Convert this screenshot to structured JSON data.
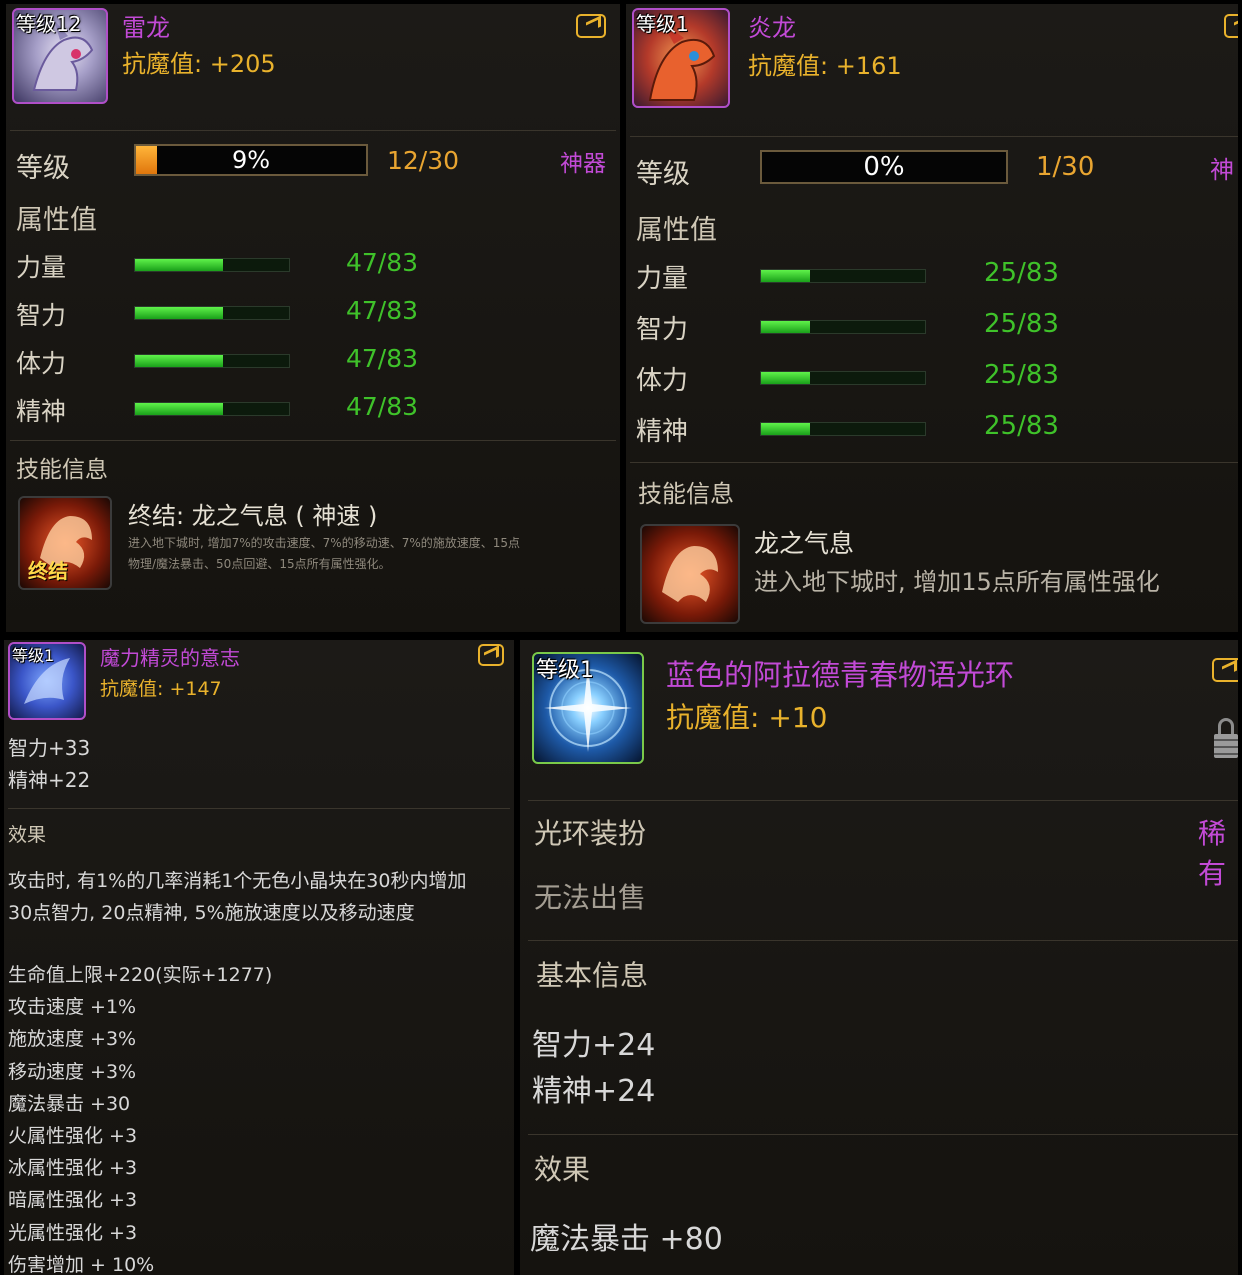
{
  "colors": {
    "name": "#c24ad6",
    "resist": "#e9b22c",
    "stat_value": "#3fc22a",
    "level_text": "#e9a531"
  },
  "p1": {
    "level_badge": "等级12",
    "name": "雷龙",
    "resist": "抗魔值: +205",
    "level_label": "等级",
    "level_percent": "9%",
    "level_progress": 0.09,
    "level_count": "12/30",
    "rarity": "神器",
    "attr_heading": "属性值",
    "stats": [
      {
        "label": "力量",
        "value": "47/83",
        "fill": 0.57
      },
      {
        "label": "智力",
        "value": "47/83",
        "fill": 0.57
      },
      {
        "label": "体力",
        "value": "47/83",
        "fill": 0.57
      },
      {
        "label": "精神",
        "value": "47/83",
        "fill": 0.57
      }
    ],
    "skill_heading": "技能信息",
    "skill_icon_text": "终结",
    "skill_name": "终结: 龙之气息 ( 神速 )",
    "skill_desc1": "进入地下城时, 增加7%的攻击速度、7%的移动速、7%的施放速度、15点",
    "skill_desc2": "物理/魔法暴击、50点回避、15点所有属性强化。"
  },
  "p2": {
    "level_badge": "等级1",
    "name": "炎龙",
    "resist": "抗魔值: +161",
    "level_label": "等级",
    "level_percent": "0%",
    "level_progress": 0.0,
    "level_count": "1/30",
    "rarity": "神",
    "attr_heading": "属性值",
    "stats": [
      {
        "label": "力量",
        "value": "25/83",
        "fill": 0.3
      },
      {
        "label": "智力",
        "value": "25/83",
        "fill": 0.3
      },
      {
        "label": "体力",
        "value": "25/83",
        "fill": 0.3
      },
      {
        "label": "精神",
        "value": "25/83",
        "fill": 0.3
      }
    ],
    "skill_heading": "技能信息",
    "skill_name": "龙之气息",
    "skill_desc": "进入地下城时, 增加15点所有属性强化"
  },
  "p3": {
    "level_badge": "等级1",
    "name": "魔力精灵的意志",
    "resist": "抗魔值: +147",
    "attrs": [
      "智力+33",
      "精神+22"
    ],
    "effect_heading": "效果",
    "effect_text1": "攻击时, 有1%的几率消耗1个无色小晶块在30秒内增加",
    "effect_text2": "30点智力, 20点精神, 5%施放速度以及移动速度",
    "bonuses": [
      "生命值上限+220(实际+1277)",
      "攻击速度 +1%",
      "施放速度 +3%",
      "移动速度 +3%",
      "魔法暴击 +30",
      "火属性强化 +3",
      "冰属性强化 +3",
      "暗属性强化 +3",
      "光属性强化 +3",
      "伤害增加 + 10%"
    ]
  },
  "p4": {
    "level_badge": "等级1",
    "name": "蓝色的阿拉德青春物语光环",
    "resist": "抗魔值: +10",
    "category": "光环装扮",
    "rarity": "稀有",
    "trade": "无法出售",
    "basic_heading": "基本信息",
    "basic": [
      "智力+24",
      "精神+24"
    ],
    "effect_heading": "效果",
    "effect": "魔法暴击 +80"
  }
}
